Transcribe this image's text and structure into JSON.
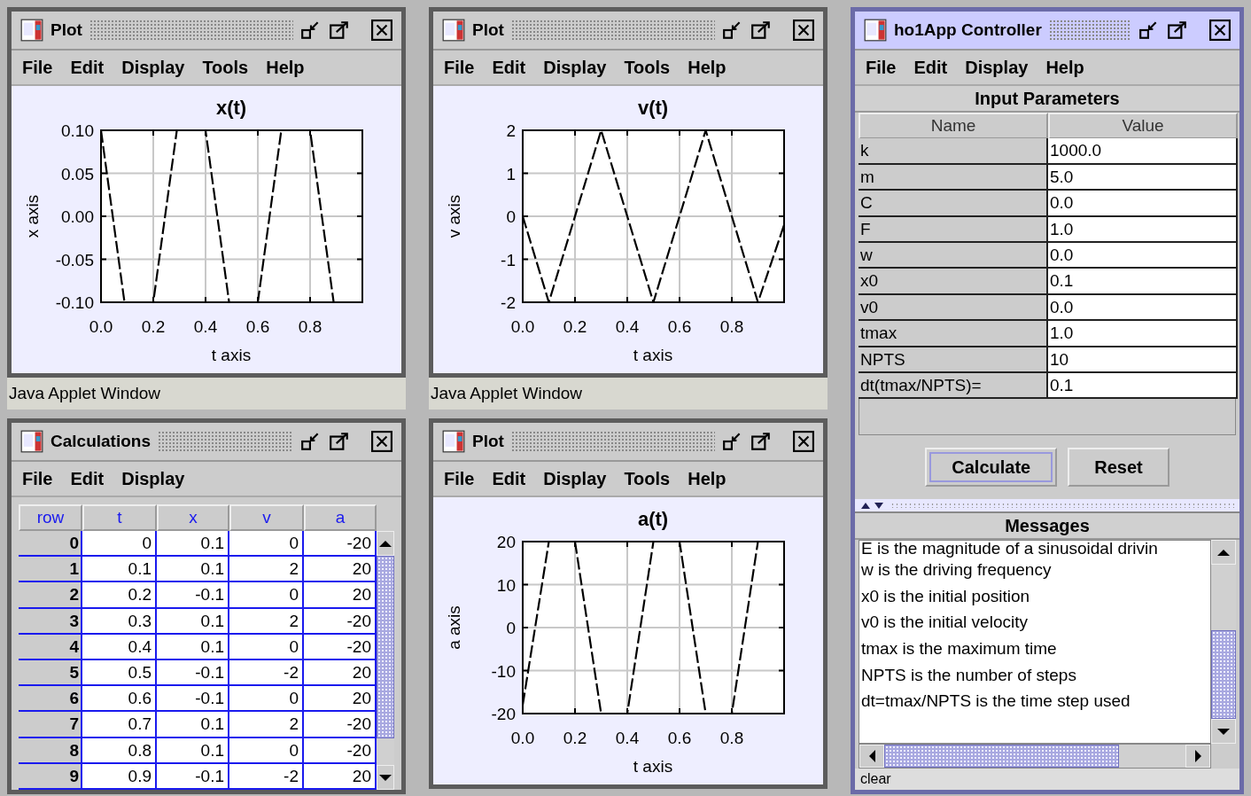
{
  "plots": [
    {
      "title": "Plot",
      "active": false,
      "menu": [
        "File",
        "Edit",
        "Display",
        "Tools",
        "Help"
      ],
      "status": "Java Applet Window",
      "chart_data": {
        "type": "line",
        "title": "x(t)",
        "xlabel": "t axis",
        "ylabel": "x axis",
        "grid": true,
        "x": [
          0,
          0.09,
          0.2,
          0.29,
          0.4,
          0.49,
          0.6,
          0.69,
          0.8,
          0.89
        ],
        "series": [
          {
            "color": "#000000",
            "line_style": "dashed",
            "values": [
              0.1,
              -0.1,
              -0.1,
              0.1,
              0.1,
              -0.1,
              -0.1,
              0.1,
              0.1,
              -0.1
            ]
          }
        ],
        "xlim": [
          0,
          1
        ],
        "ylim": [
          -0.1,
          0.1
        ],
        "xticks": [
          {
            "value": 0,
            "label": "0.0"
          },
          {
            "value": 0.2,
            "label": "0.2"
          },
          {
            "value": 0.4,
            "label": "0.4"
          },
          {
            "value": 0.6,
            "label": "0.6"
          },
          {
            "value": 0.8,
            "label": "0.8"
          }
        ],
        "yticks": [
          {
            "value": 0.1,
            "label": "0.10"
          },
          {
            "value": 0.05,
            "label": "0.05"
          },
          {
            "value": 0,
            "label": "0.00"
          },
          {
            "value": -0.05,
            "label": "-0.05"
          },
          {
            "value": -0.1,
            "label": "-0.10"
          }
        ]
      }
    },
    {
      "title": "Plot",
      "active": false,
      "menu": [
        "File",
        "Edit",
        "Display",
        "Tools",
        "Help"
      ],
      "status": "Java Applet Window",
      "chart_data": {
        "type": "line",
        "title": "v(t)",
        "xlabel": "t axis",
        "ylabel": "v axis",
        "grid": true,
        "x": [
          0,
          0.1,
          0.3,
          0.5,
          0.7,
          0.9,
          1.0
        ],
        "series": [
          {
            "color": "#000000",
            "line_style": "dashed",
            "values": [
              0,
              -2,
              2,
              -2,
              2,
              -2,
              -0.2
            ]
          }
        ],
        "xlim": [
          0,
          1
        ],
        "ylim": [
          -2,
          2
        ],
        "xticks": [
          {
            "value": 0,
            "label": "0.0"
          },
          {
            "value": 0.2,
            "label": "0.2"
          },
          {
            "value": 0.4,
            "label": "0.4"
          },
          {
            "value": 0.6,
            "label": "0.6"
          },
          {
            "value": 0.8,
            "label": "0.8"
          }
        ],
        "yticks": [
          2,
          1,
          0,
          -1,
          -2
        ]
      }
    },
    {
      "title": "Plot",
      "active": false,
      "menu": [
        "File",
        "Edit",
        "Display",
        "Tools",
        "Help"
      ],
      "chart_data": {
        "type": "line",
        "title": "a(t)",
        "xlabel": "t axis",
        "ylabel": "a axis",
        "grid": true,
        "x": [
          0,
          0.1,
          0.2,
          0.3,
          0.4,
          0.5,
          0.6,
          0.7,
          0.8,
          0.9
        ],
        "series": [
          {
            "color": "#000000",
            "line_style": "dashed",
            "values": [
              -18,
              20,
              20,
              -20,
              -20,
              20,
              20,
              -20,
              -20,
              20
            ]
          }
        ],
        "xlim": [
          0,
          1
        ],
        "ylim": [
          -20,
          20
        ],
        "xticks": [
          {
            "value": 0,
            "label": "0.0"
          },
          {
            "value": 0.2,
            "label": "0.2"
          },
          {
            "value": 0.4,
            "label": "0.4"
          },
          {
            "value": 0.6,
            "label": "0.6"
          },
          {
            "value": 0.8,
            "label": "0.8"
          }
        ],
        "yticks": [
          20,
          10,
          0,
          -10,
          -20
        ]
      }
    }
  ],
  "calculations": {
    "title": "Calculations",
    "active": false,
    "menu": [
      "File",
      "Edit",
      "Display"
    ],
    "columns": [
      "row",
      "t",
      "x",
      "v",
      "a"
    ],
    "rows": [
      [
        "0",
        "0",
        "0.1",
        "0",
        "-20"
      ],
      [
        "1",
        "0.1",
        "0.1",
        "2",
        "20"
      ],
      [
        "2",
        "0.2",
        "-0.1",
        "0",
        "20"
      ],
      [
        "3",
        "0.3",
        "0.1",
        "2",
        "-20"
      ],
      [
        "4",
        "0.4",
        "0.1",
        "0",
        "-20"
      ],
      [
        "5",
        "0.5",
        "-0.1",
        "-2",
        "20"
      ],
      [
        "6",
        "0.6",
        "-0.1",
        "0",
        "20"
      ],
      [
        "7",
        "0.7",
        "0.1",
        "2",
        "-20"
      ],
      [
        "8",
        "0.8",
        "0.1",
        "0",
        "-20"
      ],
      [
        "9",
        "0.9",
        "-0.1",
        "-2",
        "20"
      ]
    ]
  },
  "controller": {
    "title": "ho1App Controller",
    "active": true,
    "menu": [
      "File",
      "Edit",
      "Display",
      "Help"
    ],
    "parameters_title": "Input Parameters",
    "columns": [
      "Name",
      "Value"
    ],
    "parameters": [
      {
        "name": "k",
        "value": "1000.0"
      },
      {
        "name": "m",
        "value": "5.0"
      },
      {
        "name": "C",
        "value": "0.0"
      },
      {
        "name": "F",
        "value": "1.0"
      },
      {
        "name": "w",
        "value": "0.0"
      },
      {
        "name": "x0",
        "value": "0.1"
      },
      {
        "name": "v0",
        "value": "0.0"
      },
      {
        "name": "tmax",
        "value": "1.0"
      },
      {
        "name": "NPTS",
        "value": "10"
      },
      {
        "name": "dt(tmax/NPTS)=",
        "value": "0.1"
      }
    ],
    "buttons": [
      {
        "label": "Calculate",
        "focused": true
      },
      {
        "label": "Reset",
        "focused": false
      }
    ],
    "messages_title": "Messages",
    "messages": [
      "E is the magnitude of a sinusoidal drivin",
      "w is the driving frequency",
      "x0 is the initial position",
      "v0 is the initial velocity",
      "tmax is the maximum time",
      "NPTS is the number of steps",
      "dt=tmax/NPTS is the time step used"
    ],
    "status": "clear"
  }
}
